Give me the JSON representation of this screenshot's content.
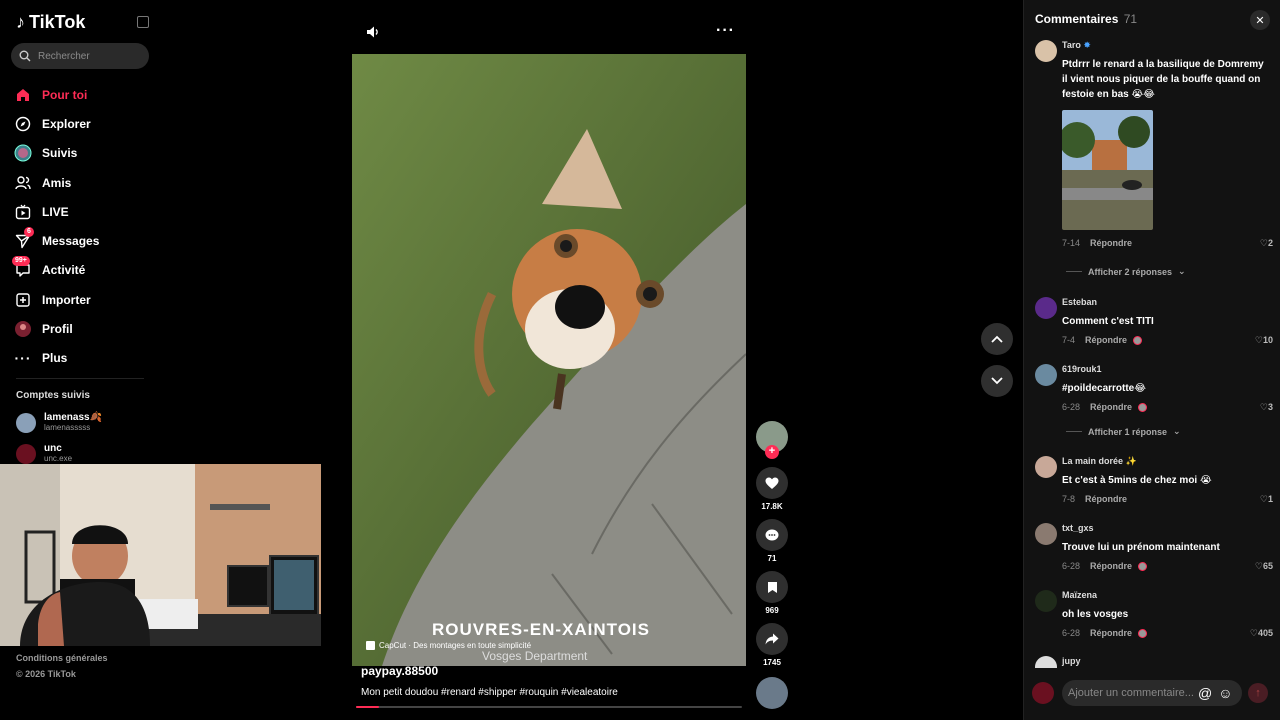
{
  "brand": {
    "name": "TikTok"
  },
  "search": {
    "placeholder": "Rechercher"
  },
  "nav": [
    {
      "label": "Pour toi",
      "icon": "home-icon",
      "active": true
    },
    {
      "label": "Explorer",
      "icon": "compass-icon"
    },
    {
      "label": "Suivis",
      "icon": "following-icon"
    },
    {
      "label": "Amis",
      "icon": "friends-icon"
    },
    {
      "label": "LIVE",
      "icon": "live-icon"
    },
    {
      "label": "Messages",
      "icon": "paper-plane-icon",
      "badge": "6"
    },
    {
      "label": "Activité",
      "icon": "chat-icon",
      "badge": "99+"
    },
    {
      "label": "Importer",
      "icon": "upload-icon"
    },
    {
      "label": "Profil",
      "icon": "profile-icon"
    },
    {
      "label": "Plus",
      "icon": "more-icon"
    }
  ],
  "following": {
    "title": "Comptes suivis",
    "accounts": [
      {
        "name": "lamenass🍂",
        "handle": "lamenasssss"
      },
      {
        "name": "unc",
        "handle": "unc.exe"
      }
    ]
  },
  "footer": {
    "terms": "Conditions générales",
    "copyright": "© 2026 TikTok"
  },
  "video": {
    "overlay_text": "ROUVRES-EN-XAINTOIS",
    "overlay_sub": "Vosges Department",
    "capcut": "CapCut · Des montages en toute simplicité",
    "author": "paypay.88500",
    "caption": "Mon petit doudou #renard #shipper #rouquin #viealeatoire",
    "progress": 0.06
  },
  "actions": {
    "likes": "17.8K",
    "comments": "71",
    "saves": "969",
    "shares": "1745"
  },
  "comments": {
    "title": "Commentaires",
    "count": "71",
    "items": [
      {
        "user": "Taro",
        "text": "Ptdrrr le renard a la basilique de Domremy il vient nous piquer de la bouffe quand on festoie en bas 😭😂",
        "date": "7-14",
        "reply": "Répondre",
        "likes": "2",
        "more": "Afficher 2 réponses"
      },
      {
        "user": "Esteban",
        "text": "Comment c'est TITI",
        "date": "7-4",
        "reply": "Répondre",
        "likes": "10"
      },
      {
        "user": "619rouk1",
        "text": "#poildecarrotte😂",
        "date": "6-28",
        "reply": "Répondre",
        "likes": "3",
        "more": "Afficher 1 réponse"
      },
      {
        "user": "La main dorée ✨",
        "text": "Et c'est à 5mins de chez moi 😭",
        "date": "7-8",
        "reply": "Répondre",
        "likes": "1"
      },
      {
        "user": "txt_gxs",
        "text": "Trouve lui un prénom maintenant",
        "date": "6-28",
        "reply": "Répondre",
        "likes": "65"
      },
      {
        "user": "Maïzena",
        "text": "oh les vosges",
        "date": "6-28",
        "reply": "Répondre",
        "likes": "405"
      },
      {
        "user": "jupy"
      }
    ],
    "input_placeholder": "Ajouter un commentaire..."
  },
  "colors": {
    "accent": "#fe2c55",
    "panel": "#121212",
    "background": "#000000"
  }
}
